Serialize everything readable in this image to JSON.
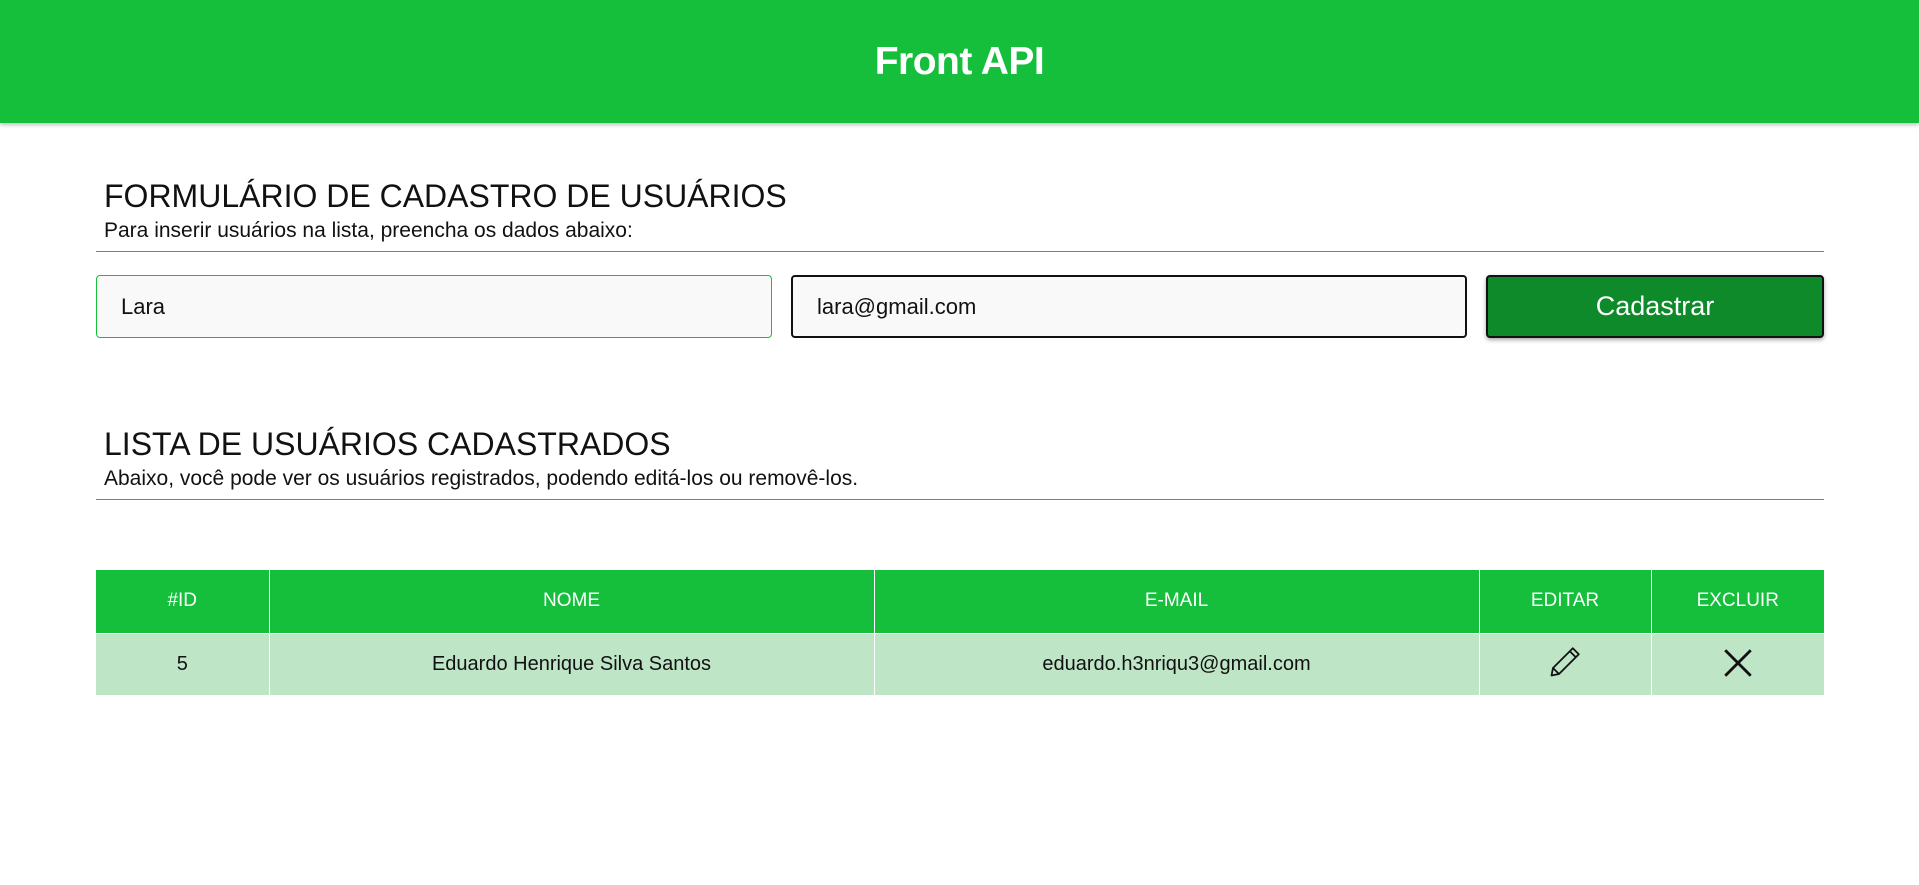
{
  "header": {
    "title": "Front API"
  },
  "form_section": {
    "title": "FORMULÁRIO DE CADASTRO DE USUÁRIOS",
    "subtitle": "Para inserir usuários na lista, preencha os dados abaixo:"
  },
  "form": {
    "name_value": "Lara",
    "email_value": "lara@gmail.com",
    "submit_label": "Cadastrar"
  },
  "list_section": {
    "title": "LISTA DE USUÁRIOS CADASTRADOS",
    "subtitle": "Abaixo, você pode ver os usuários registrados, podendo editá-los ou removê-los."
  },
  "table": {
    "headers": [
      "#ID",
      "NOME",
      "E-MAIL",
      "EDITAR",
      "EXCLUIR"
    ],
    "rows": [
      {
        "id": "5",
        "name": "Eduardo Henrique Silva Santos",
        "email": "eduardo.h3nriqu3@gmail.com",
        "edit_icon": "pencil-icon",
        "delete_icon": "close-icon"
      }
    ]
  },
  "colors": {
    "primary": "#15bf3c",
    "button_dark": "#0e8a2b",
    "row_bg": "#bfe5c7"
  }
}
